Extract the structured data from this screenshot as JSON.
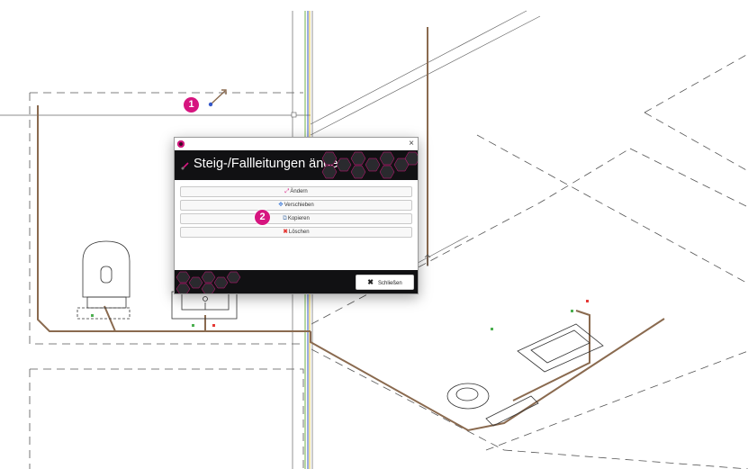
{
  "colors": {
    "accent": "#d6157f",
    "pipe": "#8a6a4f",
    "dialog_dark": "#111113"
  },
  "callouts": {
    "first": "1",
    "second": "2"
  },
  "dialog": {
    "title_icon": "app-logo-icon",
    "close_glyph": "×",
    "header_title": "Steig-/Fallleitungen ändern",
    "buttons": [
      {
        "label": "Ändern",
        "icon": "pipe-edit-icon"
      },
      {
        "label": "Verschieben",
        "icon": "move-icon"
      },
      {
        "label": "Kopieren",
        "icon": "copy-icon"
      },
      {
        "label": "Löschen",
        "icon": "delete-icon"
      }
    ],
    "close_button": {
      "label": "Schließen",
      "icon": "close-x-icon"
    }
  }
}
